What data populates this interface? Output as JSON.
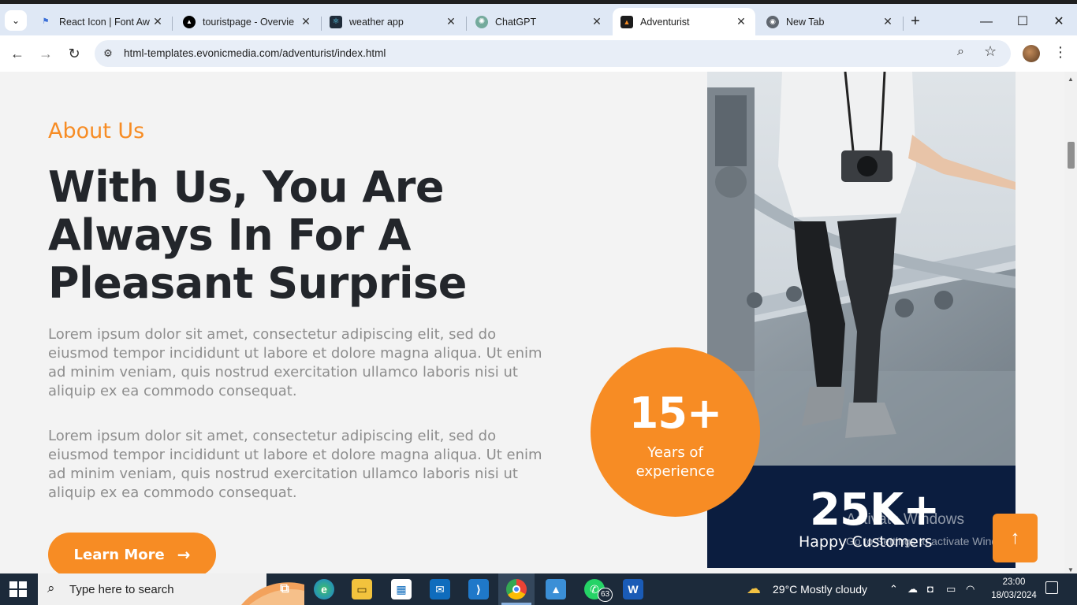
{
  "browser": {
    "tabs": [
      {
        "label": "React Icon | Font Awe",
        "close": "✕",
        "icon": "flag-icon",
        "active": false
      },
      {
        "label": "touristpage - Overvie",
        "close": "✕",
        "icon": "vercel-triangle-icon",
        "active": false
      },
      {
        "label": "weather app",
        "close": "✕",
        "icon": "react-atom-icon",
        "active": false
      },
      {
        "label": "ChatGPT",
        "close": "✕",
        "icon": "chatgpt-icon",
        "active": false
      },
      {
        "label": "Adventurist",
        "close": "✕",
        "icon": "mountain-icon",
        "active": true
      },
      {
        "label": "New Tab",
        "close": "✕",
        "icon": "chrome-icon",
        "active": false
      }
    ],
    "new_tab": "+",
    "window_controls": {
      "minimize": "—",
      "maximize": "☐",
      "close": "✕"
    },
    "url": "html-templates.evonicmedia.com/adventurist/index.html"
  },
  "page": {
    "about_label": "About Us",
    "headline": "With Us, You Are Always In For A Pleasant Surprise",
    "paragraph_1": "Lorem ipsum dolor sit amet, consectetur adipiscing elit, sed do eiusmod tempor incididunt ut labore et dolore magna aliqua. Ut enim ad minim veniam, quis nostrud exercitation ullamco laboris nisi ut aliquip ex ea commodo consequat.",
    "paragraph_2": "Lorem ipsum dolor sit amet, consectetur adipiscing elit, sed do eiusmod tempor incididunt ut labore et dolore magna aliqua. Ut enim ad minim veniam, quis nostrud exercitation ullamco laboris nisi ut aliquip ex ea commodo consequat.",
    "learn_more": "Learn More",
    "learn_more_arrow": "→",
    "years_value": "15+",
    "years_label": "Years of experience",
    "customers_value": "25K+",
    "customers_label": "Happy Customers",
    "back_to_top": "↑",
    "accent_color": "#f78c24",
    "navy_color": "#0b1d3f"
  },
  "watermark": {
    "line1": "Activate Windows",
    "line2": "Go to Settings to activate Windows."
  },
  "taskbar": {
    "search_placeholder": "Type here to search",
    "whatsapp_badge": "63",
    "weather": "29°C  Mostly cloudy",
    "time": "23:00",
    "date": "18/03/2024"
  }
}
